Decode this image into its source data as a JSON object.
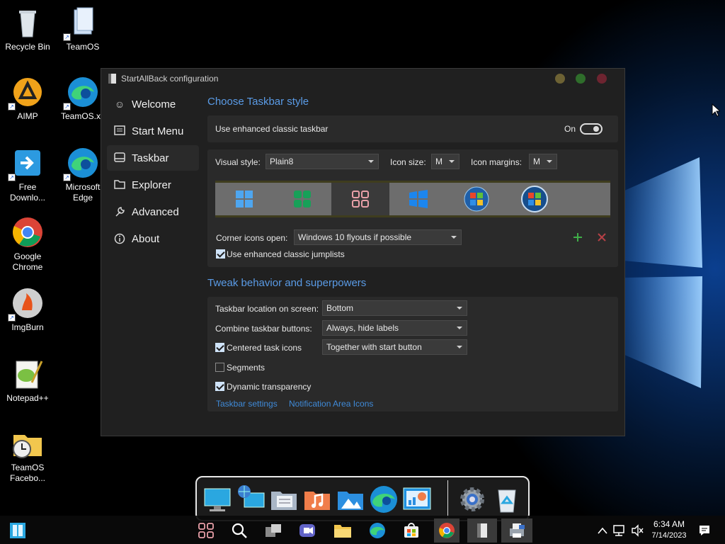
{
  "desktop": {
    "icons": [
      {
        "label": "Recycle Bin",
        "icon": "recycle-bin-icon"
      },
      {
        "label": "TeamOS",
        "icon": "folder-icon"
      },
      {
        "label": "AIMP",
        "icon": "aimp-icon"
      },
      {
        "label": "TeamOS.xy",
        "icon": "edge-icon"
      },
      {
        "label": "Free Downlo...",
        "icon": "free-download-manager-icon"
      },
      {
        "label": "Microsoft Edge",
        "icon": "edge-icon"
      },
      {
        "label": "Google Chrome",
        "icon": "chrome-icon"
      },
      {
        "label": "ImgBurn",
        "icon": "imgburn-icon"
      },
      {
        "label": "Notepad++",
        "icon": "notepadpp-icon"
      },
      {
        "label": "TeamOS Facebo...",
        "icon": "clock-folder-icon"
      }
    ]
  },
  "window": {
    "title": "StartAllBack configuration",
    "nav": [
      {
        "label": "Welcome",
        "icon": "smiley-icon"
      },
      {
        "label": "Start Menu",
        "icon": "start-menu-icon"
      },
      {
        "label": "Taskbar",
        "icon": "taskbar-icon",
        "active": true
      },
      {
        "label": "Explorer",
        "icon": "folder-icon"
      },
      {
        "label": "Advanced",
        "icon": "wrench-icon"
      },
      {
        "label": "About",
        "icon": "info-icon"
      }
    ],
    "taskbar_style": {
      "title": "Choose Taskbar style",
      "enhanced_label": "Use enhanced classic taskbar",
      "toggle_state": "On",
      "visual_style_label": "Visual style:",
      "visual_style_value": "Plain8",
      "icon_size_label": "Icon size:",
      "icon_size_value": "M",
      "icon_margins_label": "Icon margins:",
      "icon_margins_value": "M",
      "selected_style_index": 2,
      "corner_icons_label": "Corner icons open:",
      "corner_icons_value": "Windows 10 flyouts if possible",
      "jumplists_label": "Use enhanced classic jumplists",
      "jumplists_checked": true
    },
    "tweak": {
      "title": "Tweak behavior and superpowers",
      "location_label": "Taskbar location on screen:",
      "location_value": "Bottom",
      "combine_label": "Combine taskbar buttons:",
      "combine_value": "Always, hide labels",
      "centered_label": "Centered task icons",
      "centered_checked": true,
      "centered_value": "Together with start button",
      "segments_label": "Segments",
      "segments_checked": false,
      "transparency_label": "Dynamic transparency",
      "transparency_checked": true,
      "link_taskbar_settings": "Taskbar settings",
      "link_notification_icons": "Notification Area Icons"
    }
  },
  "taskbar": {
    "time": "6:34 AM",
    "date": "7/14/2023"
  },
  "colors": {
    "accent": "#5a9be6",
    "link": "#3f8ad8",
    "window_bg": "#202020",
    "panel_bg": "#2a2a2a"
  }
}
